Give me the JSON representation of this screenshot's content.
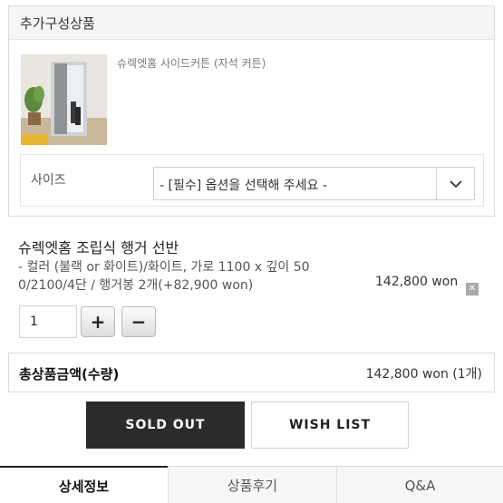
{
  "addon": {
    "header": "추가구성상품",
    "product_name": "슈렉엣홈 사이드커튼 (자석 커튼)",
    "size_label": "사이즈",
    "size_select_value": "- [필수] 옵션을 선택해 주세요 -",
    "thumbnail_icon": "product-photo-icon"
  },
  "selected": {
    "title": "슈렉엣홈 조립식 행거 선반",
    "option_line1": "- 컬러 (불랙 or 화이트)/화이트, 가로 1100 x 깊이 50",
    "option_line2": "0/2100/4단 / 행거봉 2개(+82,900 won)",
    "price": "142,800 won",
    "remove_glyph": "✕",
    "quantity": "1",
    "plus_glyph": "+",
    "minus_glyph": "−"
  },
  "total": {
    "label": "총상품금액(수량)",
    "value": "142,800 won (1개)"
  },
  "actions": {
    "sold_out": "SOLD OUT",
    "wish_list": "WISH LIST"
  },
  "tabs": [
    {
      "label": "상세정보",
      "active": true
    },
    {
      "label": "상품후기",
      "active": false
    },
    {
      "label": "Q&A",
      "active": false
    }
  ],
  "colors": {
    "sold_out_bg": "#2b2b2b",
    "border": "#d9d9d9",
    "header_bg": "#f5f5f5"
  }
}
